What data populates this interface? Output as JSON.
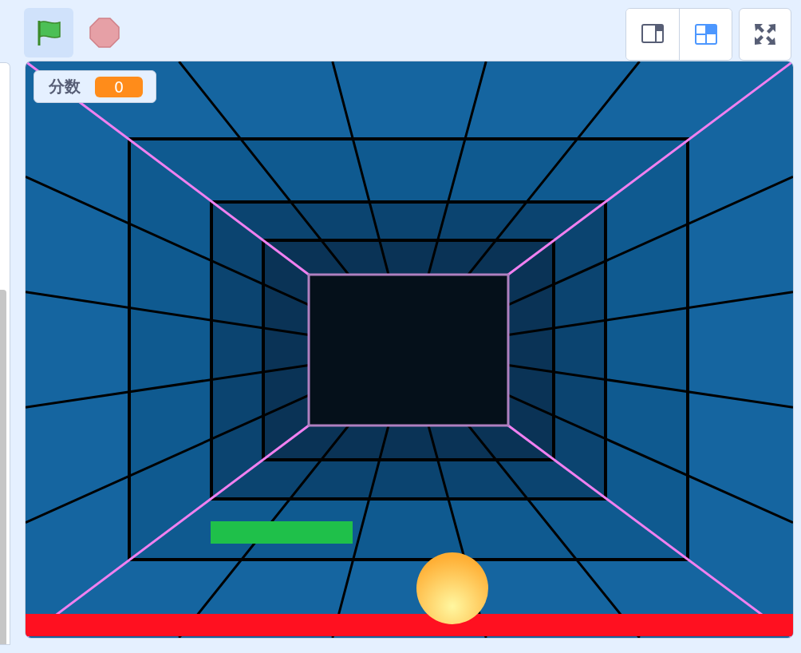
{
  "toolbar": {
    "green_flag": {
      "active": true
    },
    "stop": {
      "active": false
    }
  },
  "layout_buttons": [
    {
      "kind": "small-stage",
      "selected": false
    },
    {
      "kind": "normal-stage",
      "selected": true
    }
  ],
  "monitor": {
    "label": "分数",
    "value": "0"
  }
}
